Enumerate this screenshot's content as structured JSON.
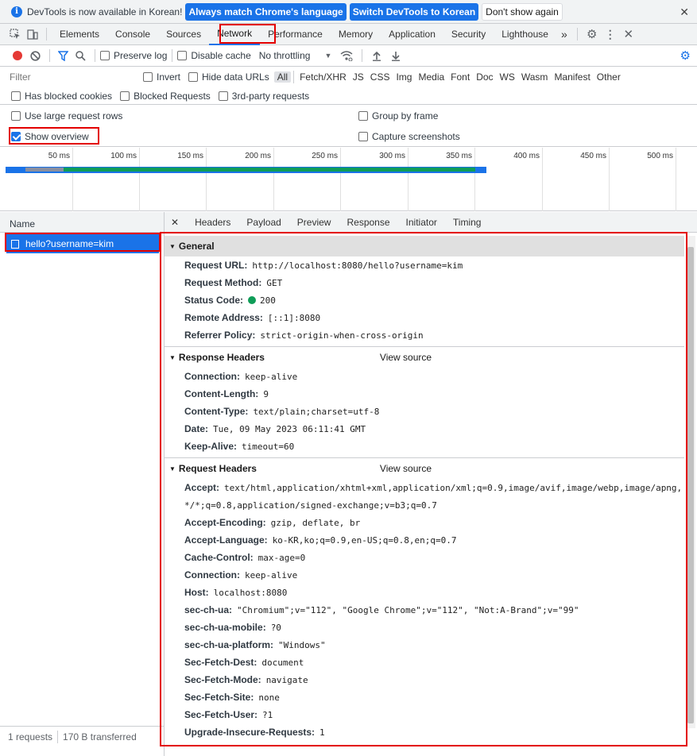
{
  "notification": {
    "message": "DevTools is now available in Korean!",
    "btn_match": "Always match Chrome's language",
    "btn_switch": "Switch DevTools to Korean",
    "btn_dont": "Don't show again"
  },
  "tabs": [
    "Elements",
    "Console",
    "Sources",
    "Network",
    "Performance",
    "Memory",
    "Application",
    "Security",
    "Lighthouse"
  ],
  "tabs_more": "»",
  "toolbar": {
    "preserve_log": "Preserve log",
    "disable_cache": "Disable cache",
    "throttling": "No throttling"
  },
  "filter": {
    "placeholder": "Filter",
    "invert": "Invert",
    "hide_data_urls": "Hide data URLs",
    "types": [
      "All",
      "Fetch/XHR",
      "JS",
      "CSS",
      "Img",
      "Media",
      "Font",
      "Doc",
      "WS",
      "Wasm",
      "Manifest",
      "Other"
    ],
    "blocked_cookies": "Has blocked cookies",
    "blocked_requests": "Blocked Requests",
    "third_party": "3rd-party requests"
  },
  "options": {
    "large_rows": "Use large request rows",
    "group_by_frame": "Group by frame",
    "show_overview": "Show overview",
    "capture_screenshots": "Capture screenshots"
  },
  "timeline_ticks": [
    "50 ms",
    "100 ms",
    "150 ms",
    "200 ms",
    "250 ms",
    "300 ms",
    "350 ms",
    "400 ms",
    "450 ms",
    "500 ms"
  ],
  "name_panel": {
    "header": "Name",
    "request": "hello?username=kim",
    "status_requests": "1 requests",
    "status_transferred": "170 B transferred"
  },
  "detail_tabs": [
    "Headers",
    "Payload",
    "Preview",
    "Response",
    "Initiator",
    "Timing"
  ],
  "general": {
    "title": "General",
    "rows": [
      {
        "k": "Request URL:",
        "v": "http://localhost:8080/hello?username=kim"
      },
      {
        "k": "Request Method:",
        "v": "GET"
      },
      {
        "k": "Status Code:",
        "v": "200"
      },
      {
        "k": "Remote Address:",
        "v": "[::1]:8080"
      },
      {
        "k": "Referrer Policy:",
        "v": "strict-origin-when-cross-origin"
      }
    ]
  },
  "response_headers": {
    "title": "Response Headers",
    "view_source": "View source",
    "rows": [
      {
        "k": "Connection:",
        "v": "keep-alive"
      },
      {
        "k": "Content-Length:",
        "v": "9"
      },
      {
        "k": "Content-Type:",
        "v": "text/plain;charset=utf-8"
      },
      {
        "k": "Date:",
        "v": "Tue, 09 May 2023 06:11:41 GMT"
      },
      {
        "k": "Keep-Alive:",
        "v": "timeout=60"
      }
    ]
  },
  "request_headers": {
    "title": "Request Headers",
    "view_source": "View source",
    "accept_k": "Accept:",
    "accept_v1": "text/html,application/xhtml+xml,application/xml;q=0.9,image/avif,image/webp,image/apng,",
    "accept_v2": "*/*;q=0.8,application/signed-exchange;v=b3;q=0.7",
    "rows": [
      {
        "k": "Accept-Encoding:",
        "v": "gzip, deflate, br"
      },
      {
        "k": "Accept-Language:",
        "v": "ko-KR,ko;q=0.9,en-US;q=0.8,en;q=0.7"
      },
      {
        "k": "Cache-Control:",
        "v": "max-age=0"
      },
      {
        "k": "Connection:",
        "v": "keep-alive"
      },
      {
        "k": "Host:",
        "v": "localhost:8080"
      },
      {
        "k": "sec-ch-ua:",
        "v": "\"Chromium\";v=\"112\", \"Google Chrome\";v=\"112\", \"Not:A-Brand\";v=\"99\""
      },
      {
        "k": "sec-ch-ua-mobile:",
        "v": "?0"
      },
      {
        "k": "sec-ch-ua-platform:",
        "v": "\"Windows\""
      },
      {
        "k": "Sec-Fetch-Dest:",
        "v": "document"
      },
      {
        "k": "Sec-Fetch-Mode:",
        "v": "navigate"
      },
      {
        "k": "Sec-Fetch-Site:",
        "v": "none"
      },
      {
        "k": "Sec-Fetch-User:",
        "v": "?1"
      },
      {
        "k": "Upgrade-Insecure-Requests:",
        "v": "1"
      }
    ]
  },
  "colors": {
    "accent": "#1a73e8",
    "highlight": "#e30000",
    "status_ok": "#0f9d58"
  }
}
